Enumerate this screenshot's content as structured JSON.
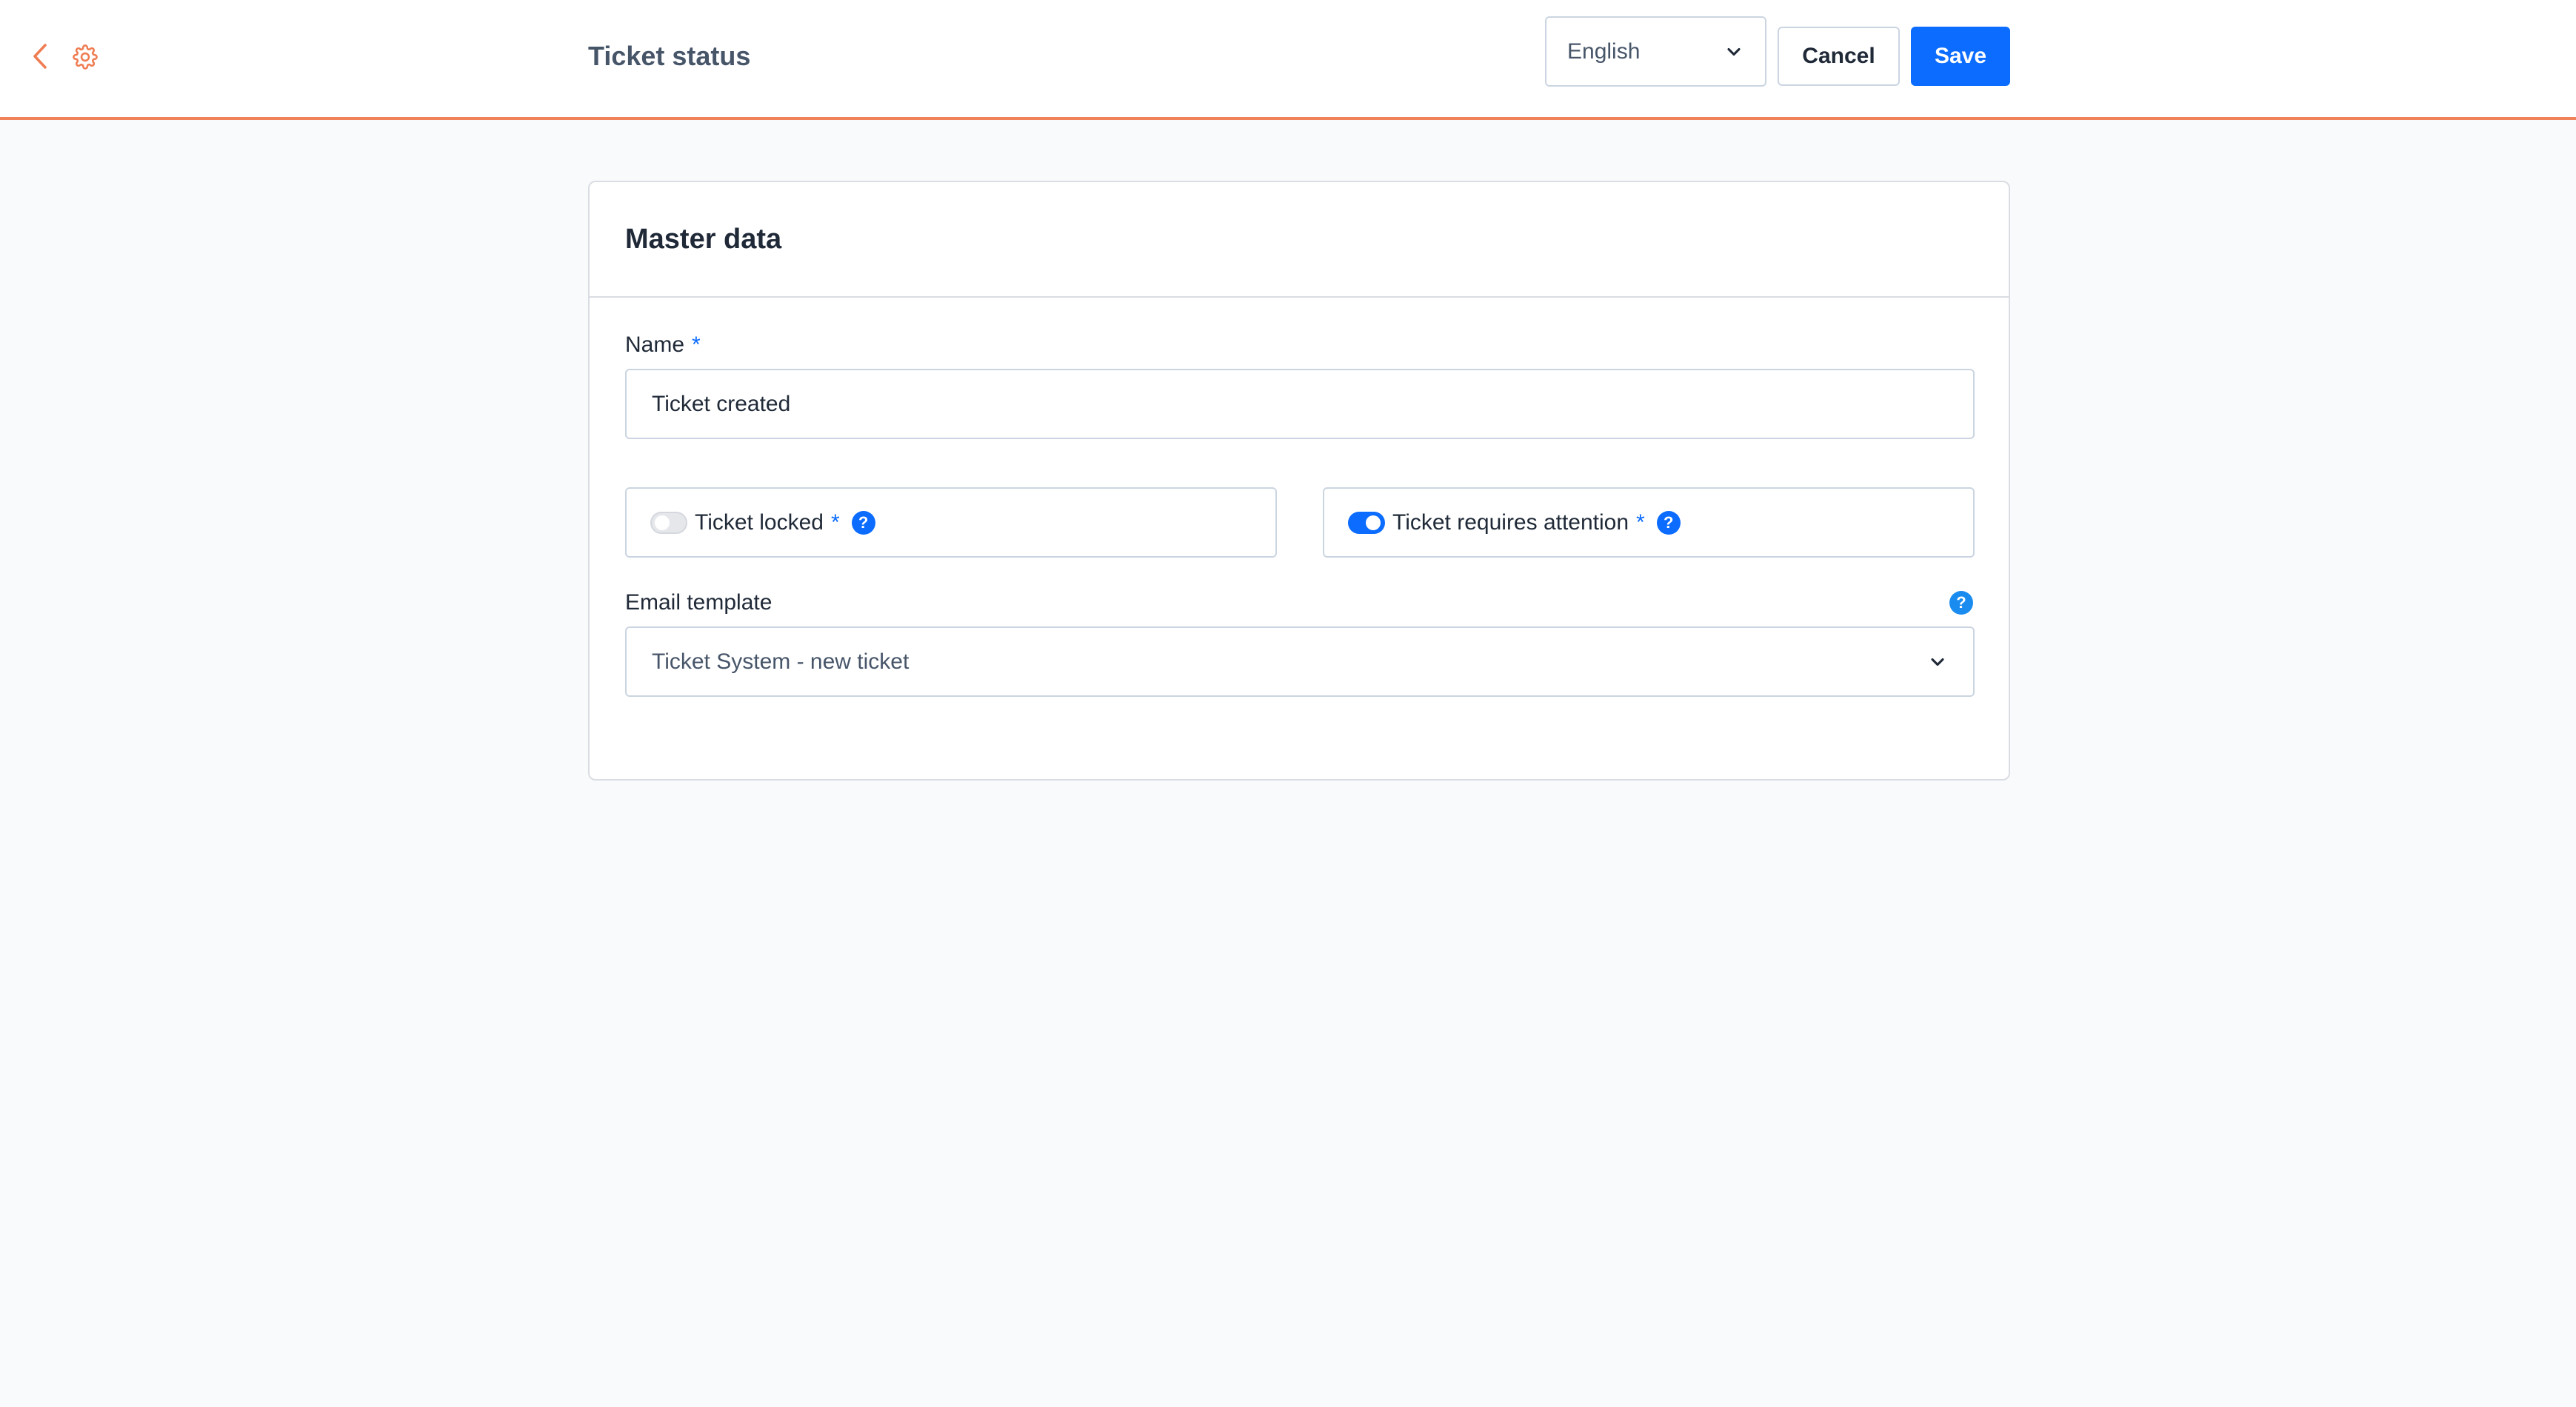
{
  "header": {
    "title": "Ticket status",
    "language": {
      "selected": "English"
    },
    "cancel_label": "Cancel",
    "save_label": "Save"
  },
  "card": {
    "title": "Master data",
    "name_field": {
      "label": "Name",
      "required_mark": "*",
      "value": "Ticket created"
    },
    "ticket_locked": {
      "label": "Ticket locked",
      "required_mark": "*",
      "enabled": false,
      "help": "?"
    },
    "ticket_requires_attention": {
      "label": "Ticket requires attention",
      "required_mark": "*",
      "enabled": true,
      "help": "?"
    },
    "email_template": {
      "label": "Email template",
      "help": "?",
      "selected": "Ticket System - new ticket"
    }
  },
  "colors": {
    "accent": "#0b6cff",
    "header_border": "#f0825a",
    "icon_color": "#ef7c52"
  },
  "icons": {
    "back": "chevron-left-icon",
    "settings": "gear-icon",
    "dropdown": "chevron-down-icon",
    "help": "question-circle-icon"
  }
}
